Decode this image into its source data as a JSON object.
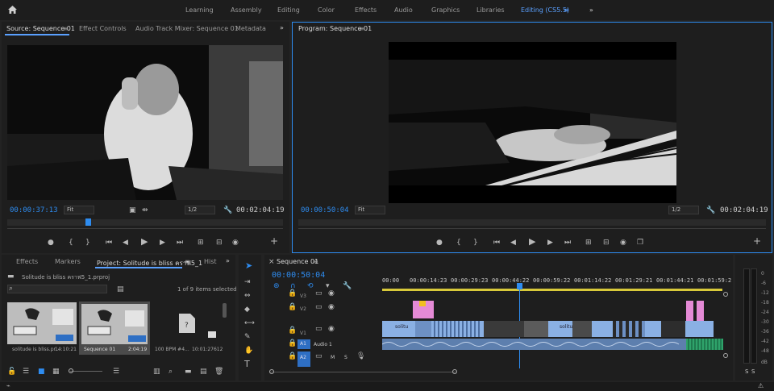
{
  "workspaces": {
    "home_icon": "home-icon",
    "tabs": [
      "Learning",
      "Assembly",
      "Editing",
      "Color",
      "Effects",
      "Audio",
      "Graphics",
      "Libraries"
    ],
    "active_tab": "Editing (CS5.5)",
    "menu_glyph": "≡",
    "more_glyph": "»"
  },
  "source_panel": {
    "tabs": [
      "Source: Sequence 01",
      "Effect Controls",
      "Audio Track Mixer: Sequence 01",
      "Metadata"
    ],
    "menu_glyph": "≡",
    "more_glyph": "»",
    "timecode": "00:00:37:13",
    "fit": "Fit",
    "resolution": "1/2",
    "duration": "00:02:04:19",
    "playhead_fraction": 0.3
  },
  "program_panel": {
    "title": "Program: Sequence 01",
    "menu_glyph": "≡",
    "timecode": "00:00:50:04",
    "fit": "Fit",
    "resolution": "1/2",
    "duration": "00:02:04:19"
  },
  "project_panel": {
    "tabs": [
      "Effects",
      "Markers",
      "Project: Solitude is bliss คราฟ5_1",
      "Hist"
    ],
    "menu_glyph": "≡",
    "more_glyph": "»",
    "project_file": "Solitude is bliss คราฟ5_1.prproj",
    "items_selected": "1 of 9 items selected",
    "bins": [
      {
        "name": "solitude is bliss.pr...",
        "duration": "14:10:21"
      },
      {
        "name": "Sequence 01",
        "duration": "2:04:19"
      },
      {
        "name": "100 BPM #4...",
        "duration": "10:01:27612"
      }
    ]
  },
  "timeline": {
    "title": "Sequence 01",
    "menu_glyph": "≡",
    "timecode": "00:00:50:04",
    "ruler": [
      "00:00",
      "00:00:14:23",
      "00:00:29:23",
      "00:00:44:22",
      "00:00:59:22",
      "00:01:14:22",
      "00:01:29:21",
      "00:01:44:21",
      "00:01:59:2"
    ],
    "tracks": {
      "v3": "V3",
      "v2": "V2",
      "v1": "V1",
      "a1_tag": "A1",
      "a1_name": "Audio 1",
      "a2_tag": "A2",
      "a2_m": "M",
      "a2_s": "S"
    },
    "clip_labels": [
      "solitu",
      "solitu"
    ]
  },
  "meter": {
    "labels": [
      "0",
      "-6",
      "-12",
      "-18",
      "-24",
      "-30",
      "-36",
      "-42",
      "-48",
      "dB"
    ],
    "solo_labels": [
      "S",
      "S"
    ]
  },
  "colors": {
    "accent": "#2e8cf0",
    "active_tab": "#5aa0ff",
    "clip_video": "#8ab0e4",
    "clip_audio_green": "#2fa36b",
    "clip_pink": "#e58ad6"
  }
}
